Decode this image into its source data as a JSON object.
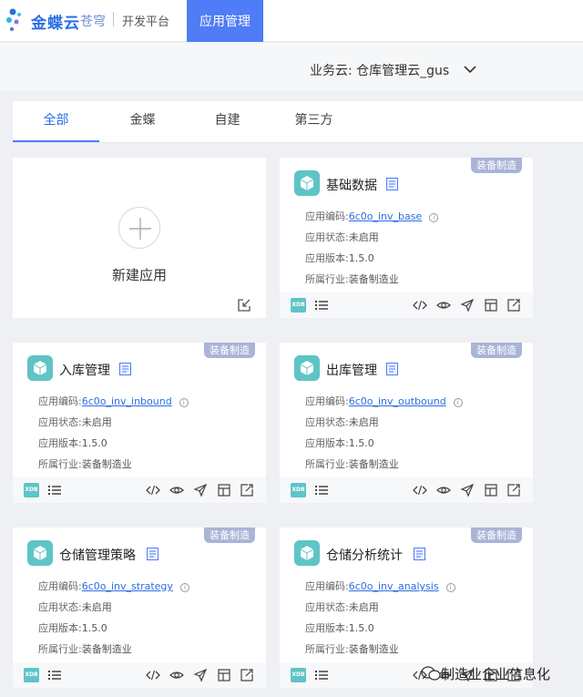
{
  "nav": {
    "brand": "金蝶云",
    "brand_sub": "苍穹",
    "platform": "开发平台",
    "active_item": "应用管理"
  },
  "business_cloud": {
    "label": "业务云:",
    "value": "仓库管理云_gus"
  },
  "tabs": [
    "全部",
    "金蝶",
    "自建",
    "第三方"
  ],
  "new_app": {
    "label": "新建应用"
  },
  "field_labels": {
    "code": "应用编码:",
    "status": "应用状态:",
    "version": "应用版本:",
    "industry": "所属行业:"
  },
  "footer_badge": "XDB",
  "apps": [
    {
      "name": "基础数据",
      "badge": "装备制造",
      "code": "6c0o_inv_base",
      "status": "未启用",
      "version": "1.5.0",
      "industry": "装备制造业"
    },
    {
      "name": "入库管理",
      "badge": "装备制造",
      "code": "6c0o_inv_inbound",
      "status": "未启用",
      "version": "1.5.0",
      "industry": "装备制造业"
    },
    {
      "name": "出库管理",
      "badge": "装备制造",
      "code": "6c0o_inv_outbound",
      "status": "未启用",
      "version": "1.5.0",
      "industry": "装备制造业"
    },
    {
      "name": "仓储管理策略",
      "badge": "装备制造",
      "code": "6c0o_inv_strategy",
      "status": "未启用",
      "version": "1.5.0",
      "industry": "装备制造业"
    },
    {
      "name": "仓储分析统计",
      "badge": "装备制造",
      "code": "6c0o_inv_analysis",
      "status": "未启用",
      "version": "1.5.0",
      "industry": "装备制造业"
    }
  ],
  "watermark": "制造业企业信息化",
  "colors": {
    "primary": "#4f7cf7",
    "badge": "#a9b4d6",
    "app_icon": "#5fc4c7",
    "link": "#2b6de5"
  }
}
